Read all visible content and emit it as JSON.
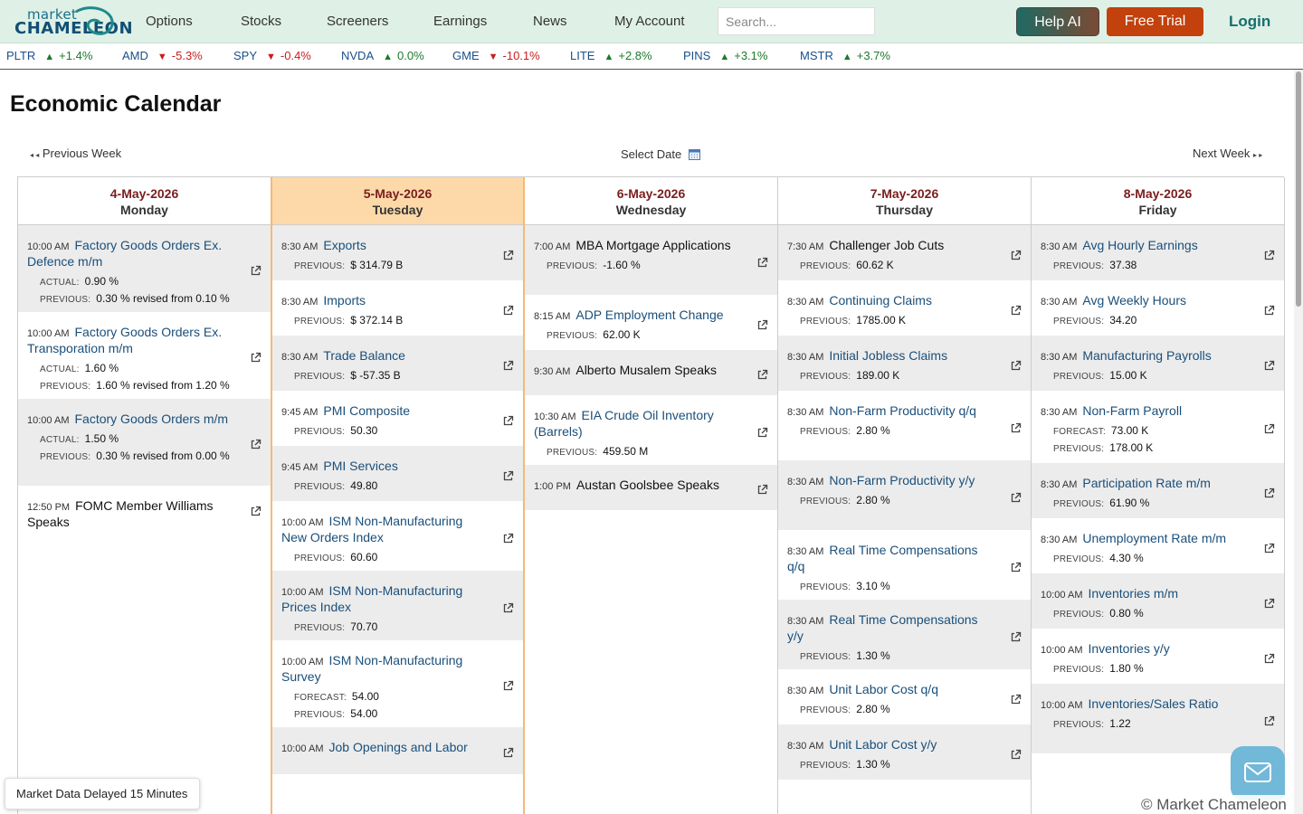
{
  "brand": {
    "line1": "market",
    "line2": "CHAMELEON"
  },
  "nav": [
    "Options",
    "Stocks",
    "Screeners",
    "Earnings",
    "News",
    "My Account"
  ],
  "search": {
    "placeholder": "Search..."
  },
  "buttons": {
    "help": "Help AI",
    "trial": "Free Trial",
    "login": "Login"
  },
  "ticker": [
    {
      "sym": "PLTR",
      "dir": "up",
      "chg": "+1.4%"
    },
    {
      "sym": "AMD",
      "dir": "down",
      "chg": "-5.3%"
    },
    {
      "sym": "SPY",
      "dir": "down",
      "chg": "-0.4%"
    },
    {
      "sym": "NVDA",
      "dir": "up",
      "chg": "0.0%"
    },
    {
      "sym": "GME",
      "dir": "down",
      "chg": "-10.1%"
    },
    {
      "sym": "LITE",
      "dir": "up",
      "chg": "+2.8%"
    },
    {
      "sym": "PINS",
      "dir": "up",
      "chg": "+3.1%"
    },
    {
      "sym": "MSTR",
      "dir": "up",
      "chg": "+3.7%"
    }
  ],
  "page_title": "Economic Calendar",
  "week_nav": {
    "prev": "Previous Week",
    "select": "Select Date",
    "next": "Next Week"
  },
  "labels": {
    "actual": "ACTUAL:",
    "previous": "PREVIOUS:",
    "forecast": "FORECAST:"
  },
  "days": [
    {
      "date": "4-May-2026",
      "dow": "Monday",
      "events": [
        {
          "time": "10:00 AM",
          "name": "Factory Goods Orders Ex. Defence m/m",
          "link": true,
          "actual": "0.90 %",
          "previous": "0.30 % revised from 0.10 %"
        },
        {
          "time": "10:00 AM",
          "name": "Factory Goods Orders Ex. Transporation m/m",
          "link": true,
          "actual": "1.60 %",
          "previous": "1.60 % revised from 1.20 %"
        },
        {
          "time": "10:00 AM",
          "name": "Factory Goods Orders m/m",
          "link": true,
          "actual": "1.50 %",
          "previous": "0.30 % revised from 0.00 %"
        },
        {
          "time": "12:50 PM",
          "name": "FOMC Member Williams Speaks",
          "link": false
        }
      ]
    },
    {
      "date": "5-May-2026",
      "dow": "Tuesday",
      "events": [
        {
          "time": "8:30 AM",
          "name": "Exports",
          "link": true,
          "previous": "$ 314.79 B"
        },
        {
          "time": "8:30 AM",
          "name": "Imports",
          "link": true,
          "previous": "$ 372.14 B"
        },
        {
          "time": "8:30 AM",
          "name": "Trade Balance",
          "link": true,
          "previous": "$ -57.35 B"
        },
        {
          "time": "9:45 AM",
          "name": "PMI Composite",
          "link": true,
          "previous": "50.30"
        },
        {
          "time": "9:45 AM",
          "name": "PMI Services",
          "link": true,
          "previous": "49.80"
        },
        {
          "time": "10:00 AM",
          "name": "ISM Non-Manufacturing New Orders Index",
          "link": true,
          "previous": "60.60"
        },
        {
          "time": "10:00 AM",
          "name": "ISM Non-Manufacturing Prices Index",
          "link": true,
          "previous": "70.70"
        },
        {
          "time": "10:00 AM",
          "name": "ISM Non-Manufacturing Survey",
          "link": true,
          "forecast": "54.00",
          "previous": "54.00"
        },
        {
          "time": "10:00 AM",
          "name": "Job Openings and Labor",
          "link": true
        }
      ]
    },
    {
      "date": "6-May-2026",
      "dow": "Wednesday",
      "events": [
        {
          "time": "7:00 AM",
          "name": "MBA Mortgage Applications",
          "link": false,
          "previous": "-1.60 %"
        },
        {
          "time": "8:15 AM",
          "name": "ADP Employment Change",
          "link": true,
          "previous": "62.00 K"
        },
        {
          "time": "9:30 AM",
          "name": "Alberto Musalem Speaks",
          "link": false
        },
        {
          "time": "10:30 AM",
          "name": "EIA Crude Oil Inventory (Barrels)",
          "link": true,
          "previous": "459.50 M"
        },
        {
          "time": "1:00 PM",
          "name": "Austan Goolsbee Speaks",
          "link": false
        }
      ]
    },
    {
      "date": "7-May-2026",
      "dow": "Thursday",
      "events": [
        {
          "time": "7:30 AM",
          "name": "Challenger Job Cuts",
          "link": false,
          "previous": "60.62 K"
        },
        {
          "time": "8:30 AM",
          "name": "Continuing Claims",
          "link": true,
          "previous": "1785.00 K"
        },
        {
          "time": "8:30 AM",
          "name": "Initial Jobless Claims",
          "link": true,
          "previous": "189.00 K"
        },
        {
          "time": "8:30 AM",
          "name": "Non-Farm Productivity q/q",
          "link": true,
          "previous": "2.80 %"
        },
        {
          "time": "8:30 AM",
          "name": "Non-Farm Productivity y/y",
          "link": true,
          "previous": "2.80 %"
        },
        {
          "time": "8:30 AM",
          "name": "Real Time Compensations q/q",
          "link": true,
          "previous": "3.10 %"
        },
        {
          "time": "8:30 AM",
          "name": "Real Time Compensations y/y",
          "link": true,
          "previous": "1.30 %"
        },
        {
          "time": "8:30 AM",
          "name": "Unit Labor Cost q/q",
          "link": true,
          "previous": "2.80 %"
        },
        {
          "time": "8:30 AM",
          "name": "Unit Labor Cost y/y",
          "link": true,
          "previous": "1.30 %"
        }
      ]
    },
    {
      "date": "8-May-2026",
      "dow": "Friday",
      "events": [
        {
          "time": "8:30 AM",
          "name": "Avg Hourly Earnings",
          "link": true,
          "previous": "37.38"
        },
        {
          "time": "8:30 AM",
          "name": "Avg Weekly Hours",
          "link": true,
          "previous": "34.20"
        },
        {
          "time": "8:30 AM",
          "name": "Manufacturing Payrolls",
          "link": true,
          "previous": "15.00 K"
        },
        {
          "time": "8:30 AM",
          "name": "Non-Farm Payroll",
          "link": true,
          "forecast": "73.00 K",
          "previous": "178.00 K"
        },
        {
          "time": "8:30 AM",
          "name": "Participation Rate m/m",
          "link": true,
          "previous": "61.90 %"
        },
        {
          "time": "8:30 AM",
          "name": "Unemployment Rate m/m",
          "link": true,
          "previous": "4.30 %"
        },
        {
          "time": "10:00 AM",
          "name": "Inventories m/m",
          "link": true,
          "previous": "0.80 %"
        },
        {
          "time": "10:00 AM",
          "name": "Inventories y/y",
          "link": true,
          "previous": "1.80 %"
        },
        {
          "time": "10:00 AM",
          "name": "Inventories/Sales Ratio",
          "link": true,
          "previous": "1.22"
        }
      ]
    }
  ],
  "footer": {
    "delayed": "Market Data Delayed 15 Minutes",
    "copyright": "© Market Chameleon"
  }
}
